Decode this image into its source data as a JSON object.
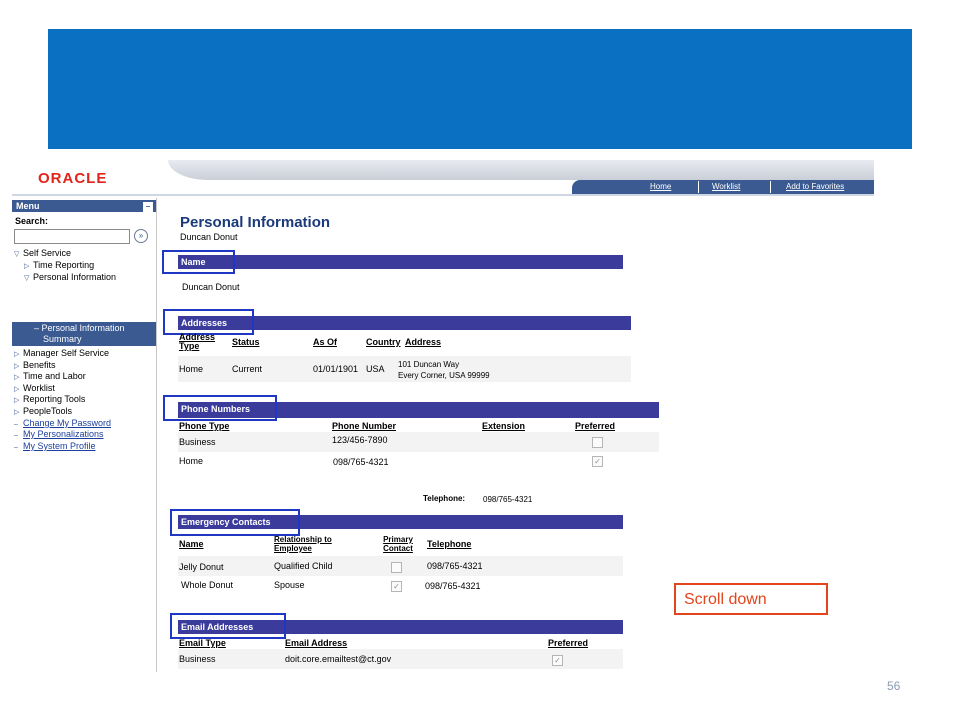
{
  "brand": {
    "logo": "ORACLE"
  },
  "nav": {
    "home": "Home",
    "worklist": "Worklist",
    "favorites": "Add to Favorites"
  },
  "menu": {
    "title": "Menu",
    "search_label": "Search:",
    "search_value": "",
    "items": [
      "Self Service",
      "Time Reporting",
      "Personal Information",
      "– Personal Information",
      "Summary",
      "Manager Self Service",
      "Benefits",
      "Time and Labor",
      "Worklist",
      "Reporting Tools",
      "PeopleTools",
      "Change My Password",
      "My Personalizations",
      "My System Profile"
    ]
  },
  "page": {
    "title": "Personal Information",
    "employee": "Duncan Donut"
  },
  "name_section": {
    "header": "Name",
    "value": "Duncan Donut"
  },
  "addresses": {
    "header": "Addresses",
    "columns": [
      "Address Type",
      "Status",
      "As Of",
      "Country",
      "Address"
    ],
    "rows": [
      {
        "type": "Home",
        "status": "Current",
        "as_of": "01/01/1901",
        "country": "USA",
        "line1": "101 Duncan Way",
        "line2": "Every Corner, USA  99999"
      }
    ]
  },
  "phones": {
    "header": "Phone Numbers",
    "columns": [
      "Phone Type",
      "Phone Number",
      "Extension",
      "Preferred"
    ],
    "rows": [
      {
        "type": "Business",
        "number": "123/456-7890",
        "extension": "",
        "preferred": false
      },
      {
        "type": "Home",
        "number": "098/765-4321",
        "extension": "",
        "preferred": true
      }
    ],
    "telephone_label": "Telephone:",
    "telephone_value": "098/765-4321"
  },
  "emergency": {
    "header": "Emergency Contacts",
    "columns": [
      "Name",
      "Relationship to Employee",
      "Primary Contact",
      "Telephone"
    ],
    "rows": [
      {
        "name": "Jelly Donut",
        "relationship": "Qualified Child",
        "primary": false,
        "phone": "098/765-4321"
      },
      {
        "name": "Whole Donut",
        "relationship": "Spouse",
        "primary": true,
        "phone": "098/765-4321"
      }
    ]
  },
  "email": {
    "header": "Email Addresses",
    "columns": [
      "Email Type",
      "Email Address",
      "Preferred"
    ],
    "rows": [
      {
        "type": "Business",
        "address": "doit.core.emailtest@ct.gov",
        "preferred": true
      }
    ]
  },
  "callout": "Scroll down",
  "slide_number": "56",
  "colors": {
    "banner": "#0a70c2",
    "section_bar": "#3b3b9c",
    "highlight": "#1f38c4",
    "callout": "#e0451d"
  }
}
